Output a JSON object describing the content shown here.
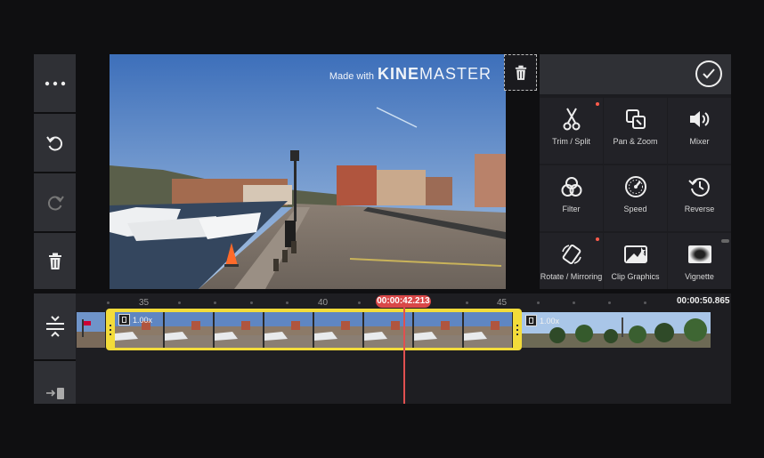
{
  "watermark": {
    "prefix": "Made with",
    "brand_bold": "KINE",
    "brand_light": "MASTER"
  },
  "panel": {
    "items": [
      {
        "label": "Trim / Split",
        "icon": "scissors-icon",
        "badge": true
      },
      {
        "label": "Pan & Zoom",
        "icon": "pan-zoom-icon",
        "badge": false
      },
      {
        "label": "Mixer",
        "icon": "speaker-icon",
        "badge": false
      },
      {
        "label": "Filter",
        "icon": "filter-circles-icon",
        "badge": false
      },
      {
        "label": "Speed",
        "icon": "speedometer-icon",
        "badge": false
      },
      {
        "label": "Reverse",
        "icon": "reverse-clock-icon",
        "badge": false
      },
      {
        "label": "Rotate / Mirroring",
        "icon": "rotate-icon",
        "badge": true
      },
      {
        "label": "Clip Graphics",
        "icon": "clip-graphics-icon",
        "badge": false
      },
      {
        "label": "Vignette",
        "icon": "vignette-icon",
        "badge": false
      }
    ]
  },
  "timeline": {
    "current_time": "00:00:42.213",
    "total_time": "00:00:50.865",
    "ruler_labels": [
      "35",
      "40",
      "45"
    ],
    "clips": [
      {
        "speed": "1.00x",
        "selected": true
      },
      {
        "speed": "1.00x",
        "selected": false
      }
    ]
  },
  "colors": {
    "accent_selection": "#f3dc3a",
    "playhead": "#e05050",
    "time_badge": "#d94848",
    "badge_dot": "#ff5b4b"
  }
}
